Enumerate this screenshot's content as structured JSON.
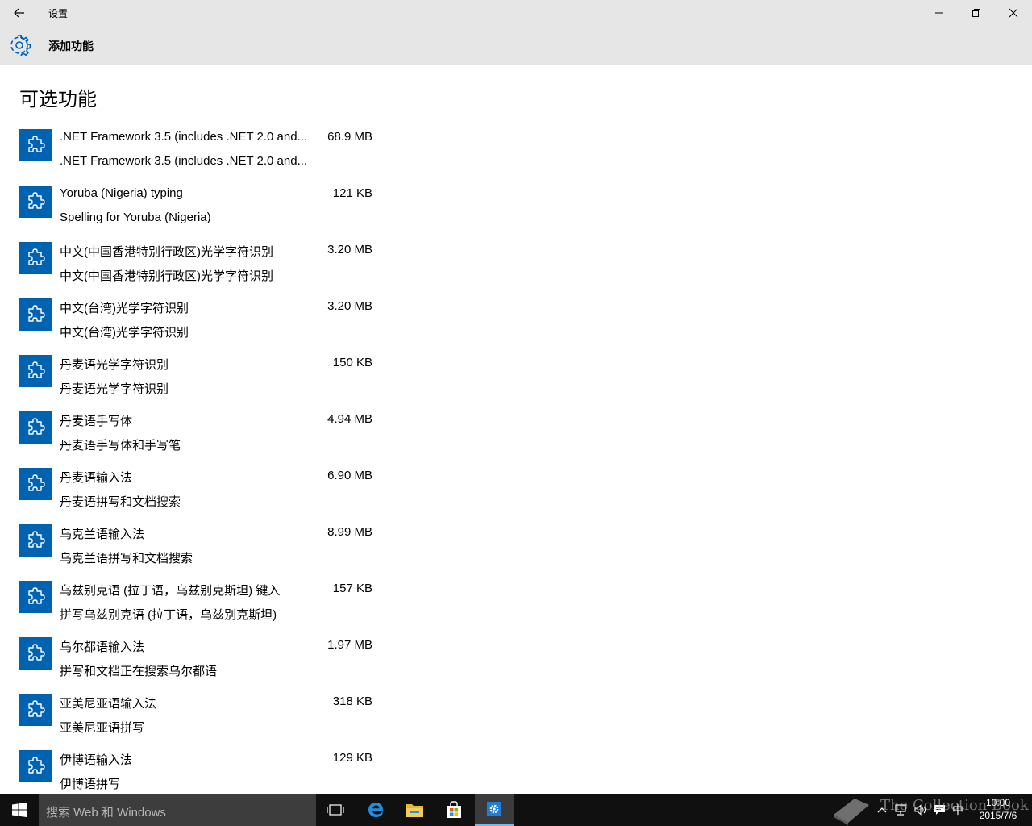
{
  "window": {
    "title": "设置",
    "back_icon": "arrow-left-icon",
    "minimize_icon": "minimize-icon",
    "maximize_icon": "restore-icon",
    "close_icon": "close-icon"
  },
  "header": {
    "icon": "gear-icon",
    "title": "添加功能",
    "accent": "#0063b1"
  },
  "main": {
    "section_title": "可选功能",
    "features": [
      {
        "name": ".NET Framework 3.5 (includes .NET 2.0 and...",
        "size": "68.9 MB",
        "description": ".NET Framework 3.5 (includes .NET 2.0 and..."
      },
      {
        "name": "Yoruba (Nigeria) typing",
        "size": "121 KB",
        "description": "Spelling for Yoruba (Nigeria)"
      },
      {
        "name": "中文(中国香港特别行政区)光学字符识别",
        "size": "3.20 MB",
        "description": "中文(中国香港特别行政区)光学字符识别"
      },
      {
        "name": "中文(台湾)光学字符识别",
        "size": "3.20 MB",
        "description": "中文(台湾)光学字符识别"
      },
      {
        "name": "丹麦语光学字符识别",
        "size": "150 KB",
        "description": "丹麦语光学字符识别"
      },
      {
        "name": "丹麦语手写体",
        "size": "4.94 MB",
        "description": "丹麦语手写体和手写笔"
      },
      {
        "name": "丹麦语输入法",
        "size": "6.90 MB",
        "description": "丹麦语拼写和文档搜索"
      },
      {
        "name": "乌克兰语输入法",
        "size": "8.99 MB",
        "description": "乌克兰语拼写和文档搜索"
      },
      {
        "name": "乌兹别克语 (拉丁语，乌兹别克斯坦) 键入",
        "size": "157 KB",
        "description": "拼写乌兹别克语 (拉丁语，乌兹别克斯坦)"
      },
      {
        "name": "乌尔都语输入法",
        "size": "1.97 MB",
        "description": "拼写和文档正在搜索乌尔都语"
      },
      {
        "name": "亚美尼亚语输入法",
        "size": "318 KB",
        "description": "亚美尼亚语拼写"
      },
      {
        "name": "伊博语输入法",
        "size": "129 KB",
        "description": "伊博语拼写"
      }
    ]
  },
  "taskbar": {
    "search_placeholder": "搜索 Web 和 Windows",
    "apps": [
      "task-view-icon",
      "edge-icon",
      "file-explorer-icon",
      "store-icon",
      "settings-icon"
    ],
    "tray": {
      "ime": "中",
      "time": "10:00",
      "date": "2015/7/6"
    },
    "watermark": "The Collection Book"
  }
}
